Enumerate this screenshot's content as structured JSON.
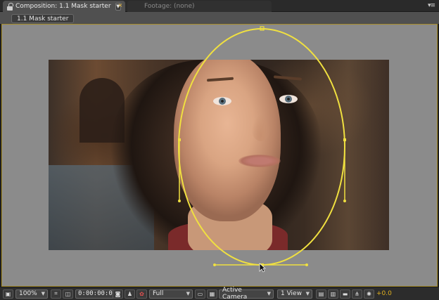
{
  "tabs": [
    {
      "title": "Composition: 1.1 Mask starter",
      "active": true
    },
    {
      "title": "Footage: (none)",
      "active": false
    }
  ],
  "panel_menu": "▾≡",
  "breadcrumb": "1.1 Mask starter",
  "toolbar": {
    "zoom": "100%",
    "timecode": "0:00:00:00",
    "resolution": "Full",
    "camera": "Active Camera",
    "views": "1 View",
    "exposure": "+0.0"
  },
  "icons": [
    "lock-icon",
    "dropdown-arrow-icon",
    "tab-close-icon",
    "panel-menu-icon",
    "always-preview-icon",
    "grid-guides-icon",
    "mask-visibility-icon",
    "snapshot-icon",
    "show-snapshot-icon",
    "color-channel-icon",
    "roi-icon",
    "transparency-grid-icon",
    "fast-previews-icon",
    "timeline-icon",
    "flowchart-icon",
    "reset-exposure-icon",
    "cursor-arrow-icon"
  ],
  "colors": {
    "mask": "#f0e040",
    "frame_border": "#a68d2a",
    "accent": "#e0b020"
  }
}
